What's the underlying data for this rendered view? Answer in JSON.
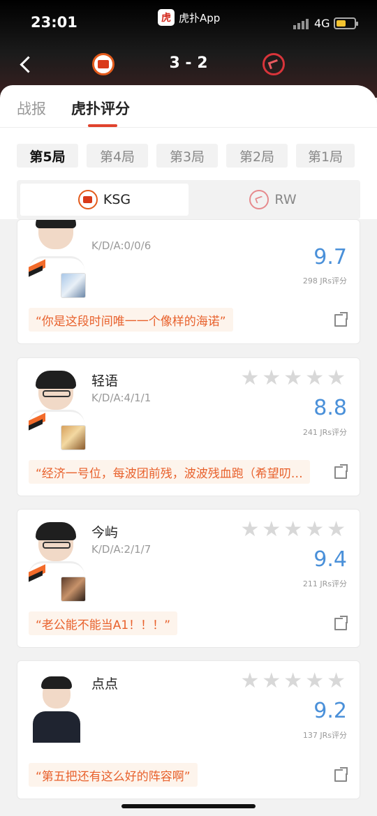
{
  "status_bar": {
    "time": "23:01",
    "network": "4G",
    "battery_level": 0.55
  },
  "app_badge": {
    "name": "虎扑App",
    "logo_char": "虎"
  },
  "match": {
    "score": "3 - 2",
    "team_left_icon": "ksg-logo-icon",
    "team_right_icon": "rw-logo-icon"
  },
  "tabs": [
    {
      "label": "战报"
    },
    {
      "label": "虎扑评分",
      "active": true
    }
  ],
  "games": [
    {
      "label": "第5局",
      "active": true
    },
    {
      "label": "第4局"
    },
    {
      "label": "第3局"
    },
    {
      "label": "第2局"
    },
    {
      "label": "第1局"
    }
  ],
  "teams": [
    {
      "name": "KSG",
      "active": true
    },
    {
      "name": "RW"
    }
  ],
  "players": [
    {
      "name": "",
      "kda": "K/D/A:0/0/6",
      "score": "9.7",
      "votes": "298 JRs评分",
      "comment": "“你是这段时间唯一一个像样的海诺”",
      "stars": 0
    },
    {
      "name": "轻语",
      "kda": "K/D/A:4/1/1",
      "score": "8.8",
      "votes": "241 JRs评分",
      "comment": "“经济一号位，每波团前残，波波残血跑（希望叨…",
      "stars": 0
    },
    {
      "name": "今屿",
      "kda": "K/D/A:2/1/7",
      "score": "9.4",
      "votes": "211 JRs评分",
      "comment": "“老公能不能当A1！！！”",
      "stars": 0
    },
    {
      "name": "点点",
      "kda": "",
      "score": "9.2",
      "votes": "137 JRs评分",
      "comment": "“第五把还有这么好的阵容啊”",
      "stars": 0
    }
  ],
  "colors": {
    "accent": "#e0422d",
    "score_blue": "#4a90d9",
    "comment_text": "#e8612c",
    "comment_bg": "#fdf4ec",
    "star_empty": "#d8d8d8"
  }
}
